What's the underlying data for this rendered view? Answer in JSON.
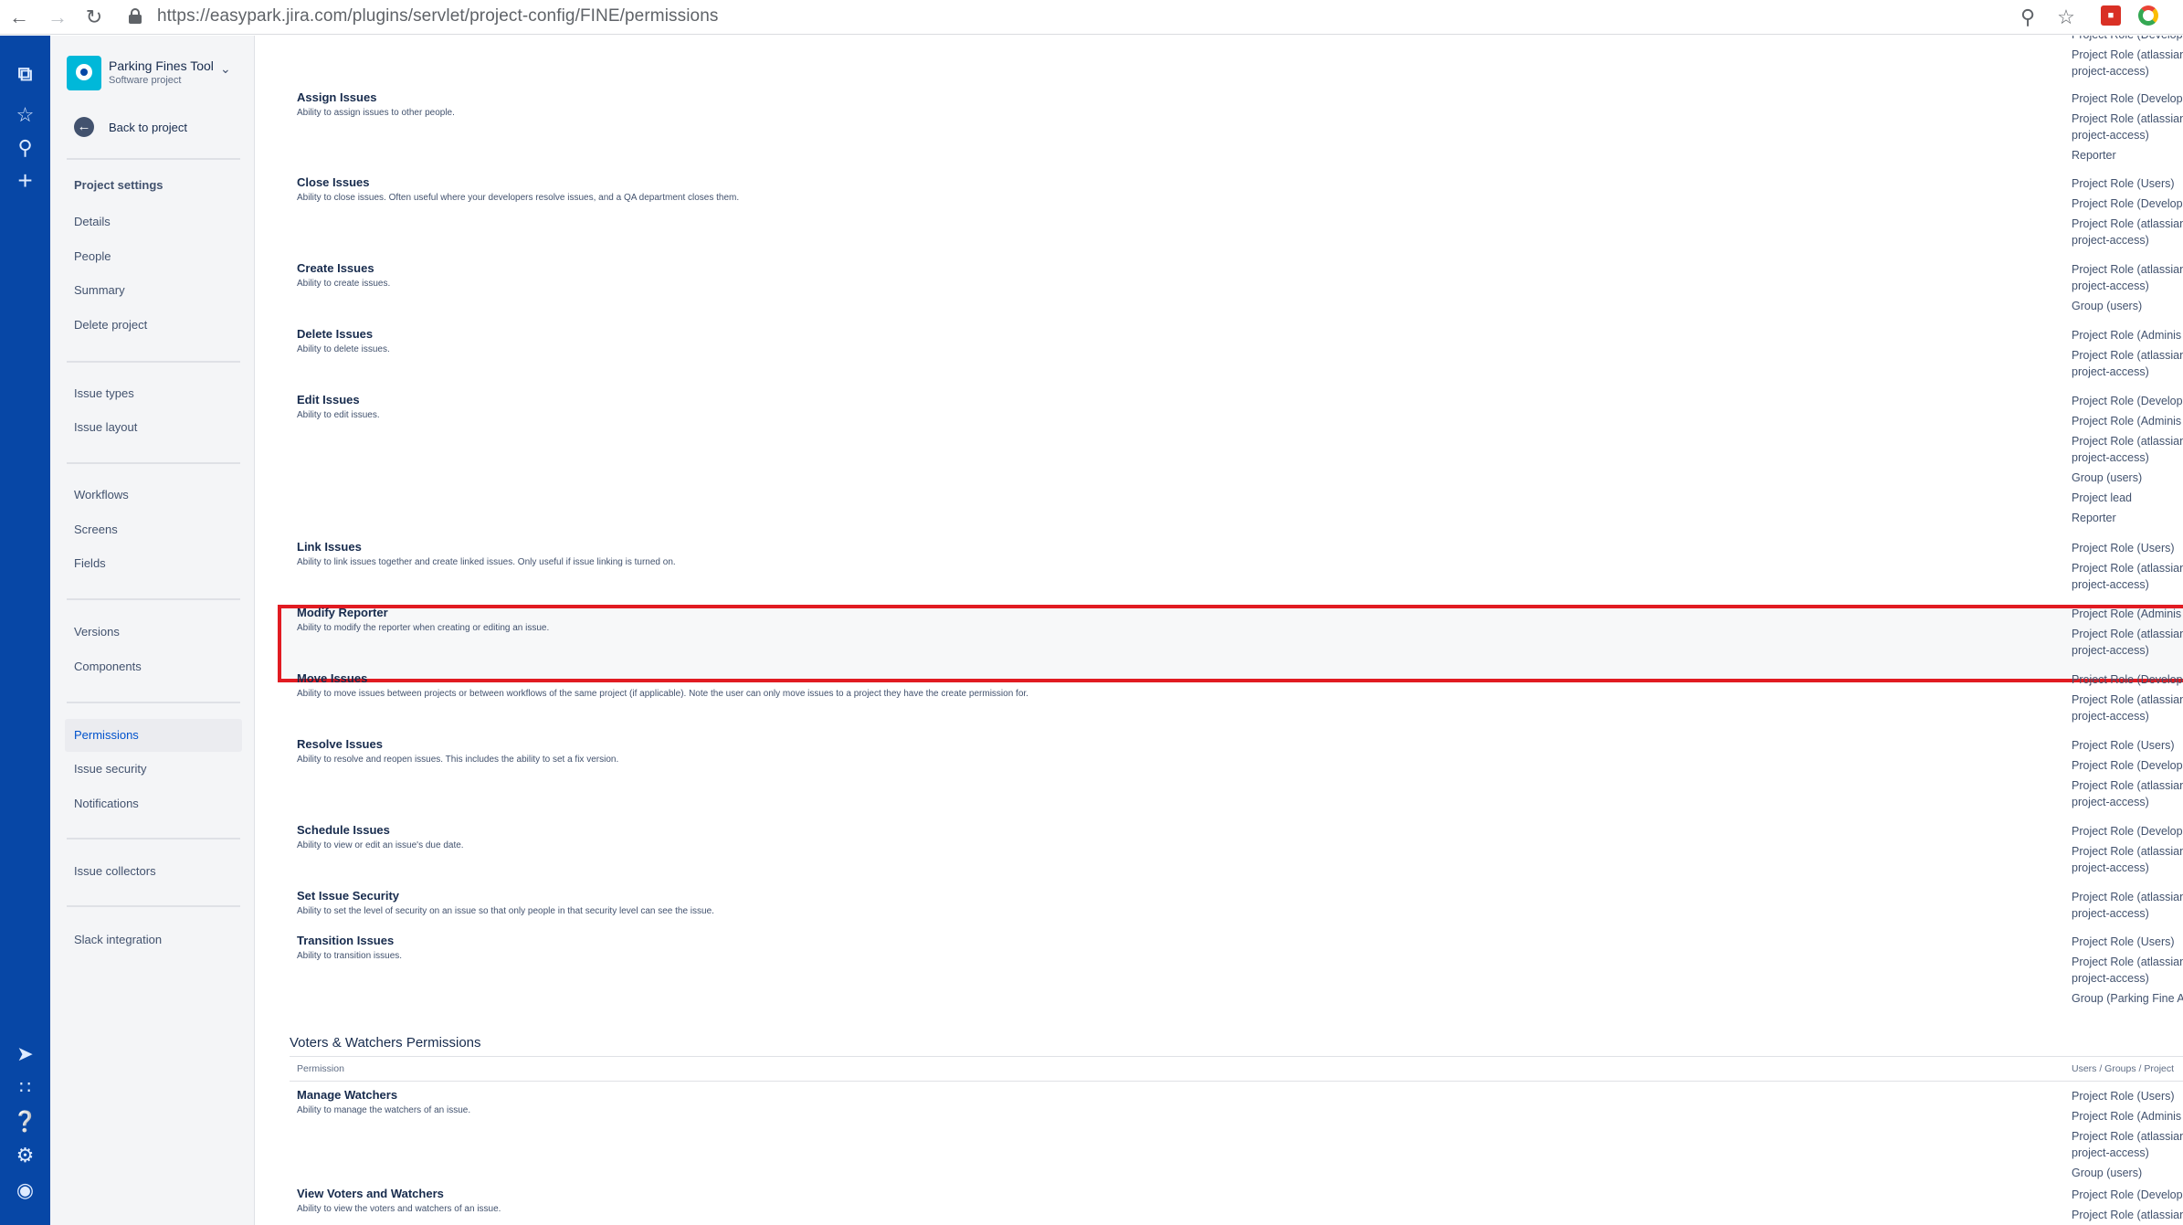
{
  "browser": {
    "url": "https://easypark.jira.com/plugins/servlet/project-config/FINE/permissions",
    "icons": [
      "back-arrow-icon",
      "forward-arrow-icon",
      "reload-icon",
      "lock-icon",
      "zoom-icon",
      "star-icon",
      "extension-icon",
      "chrome-icon"
    ]
  },
  "global_nav": {
    "icons": [
      "jira-logo-icon",
      "star-icon",
      "search-icon",
      "create-icon",
      "rocket-icon",
      "app-switcher-icon",
      "help-icon",
      "settings-icon",
      "user-avatar"
    ]
  },
  "project": {
    "name": "Parking Fines Tool",
    "type": "Software project",
    "back_label": "Back to project"
  },
  "sidebar": {
    "heading": "Project settings",
    "groups": [
      [
        "Details",
        "People",
        "Summary",
        "Delete project"
      ],
      [
        "Issue types",
        "Issue layout"
      ],
      [
        "Workflows",
        "Screens",
        "Fields"
      ],
      [
        "Versions",
        "Components"
      ],
      [
        "Permissions",
        "Issue security",
        "Notifications"
      ],
      [
        "Issue collectors"
      ],
      [
        "Slack integration"
      ]
    ],
    "active_item": "Permissions"
  },
  "top_grants": [
    "Project Role (Develop",
    "Project Role (atlassian",
    "project-access)"
  ],
  "permissions": [
    {
      "name": "Assign Issues",
      "description": "Ability to assign issues to other people.",
      "grants": [
        "Project Role (Develop",
        "Project Role (atlassian",
        "project-access)",
        "Reporter"
      ]
    },
    {
      "name": "Close Issues",
      "description": "Ability to close issues. Often useful where your developers resolve issues, and a QA department closes them.",
      "grants": [
        "Project Role (Users)",
        "Project Role (Develop",
        "Project Role (atlassian",
        "project-access)"
      ]
    },
    {
      "name": "Create Issues",
      "description": "Ability to create issues.",
      "grants": [
        "Project Role (atlassian",
        "project-access)",
        "Group (users)"
      ]
    },
    {
      "name": "Delete Issues",
      "description": "Ability to delete issues.",
      "grants": [
        "Project Role (Adminis",
        "Project Role (atlassian",
        "project-access)"
      ]
    },
    {
      "name": "Edit Issues",
      "description": "Ability to edit issues.",
      "grants": [
        "Project Role (Develop",
        "Project Role (Adminis",
        "Project Role (atlassian",
        "project-access)",
        "Group (users)",
        "Project lead",
        "Reporter"
      ]
    },
    {
      "name": "Link Issues",
      "description": "Ability to link issues together and create linked issues. Only useful if issue linking is turned on.",
      "grants": [
        "Project Role (Users)",
        "Project Role (atlassian",
        "project-access)"
      ]
    },
    {
      "name": "Modify Reporter",
      "description": "Ability to modify the reporter when creating or editing an issue.",
      "grants": [
        "Project Role (Adminis",
        "Project Role (atlassian",
        "project-access)"
      ]
    },
    {
      "name": "Move Issues",
      "description": "Ability to move issues between projects or between workflows of the same project (if applicable). Note the user can only move issues to a project they have the create permission for.",
      "grants": [
        "Project Role (Develop",
        "Project Role (atlassian",
        "project-access)"
      ]
    },
    {
      "name": "Resolve Issues",
      "description": "Ability to resolve and reopen issues. This includes the ability to set a fix version.",
      "grants": [
        "Project Role (Users)",
        "Project Role (Develop",
        "Project Role (atlassian",
        "project-access)"
      ]
    },
    {
      "name": "Schedule Issues",
      "description": "Ability to view or edit an issue's due date.",
      "grants": [
        "Project Role (Develop",
        "Project Role (atlassian",
        "project-access)"
      ]
    },
    {
      "name": "Set Issue Security",
      "description": "Ability to set the level of security on an issue so that only people in that security level can see the issue.",
      "grants": [
        "Project Role (atlassian",
        "project-access)"
      ]
    },
    {
      "name": "Transition Issues",
      "description": "Ability to transition issues.",
      "grants": [
        "Project Role (Users)",
        "Project Role (atlassian",
        "project-access)",
        "Group (Parking Fine A"
      ]
    }
  ],
  "voters_section": {
    "title": "Voters & Watchers Permissions",
    "col_permission": "Permission",
    "col_grants": "Users / Groups / Project",
    "permissions": [
      {
        "name": "Manage Watchers",
        "description": "Ability to manage the watchers of an issue.",
        "grants": [
          "Project Role (Users)",
          "Project Role (Adminis",
          "Project Role (atlassian",
          "project-access)",
          "Group (users)"
        ]
      },
      {
        "name": "View Voters and Watchers",
        "description": "Ability to view the voters and watchers of an issue.",
        "grants": [
          "Project Role (Develop",
          "Project Role (atlassian"
        ]
      }
    ]
  },
  "colors": {
    "nav_blue": "#0747a6",
    "highlight_red": "#e11b22",
    "active_link": "#0052cc"
  }
}
